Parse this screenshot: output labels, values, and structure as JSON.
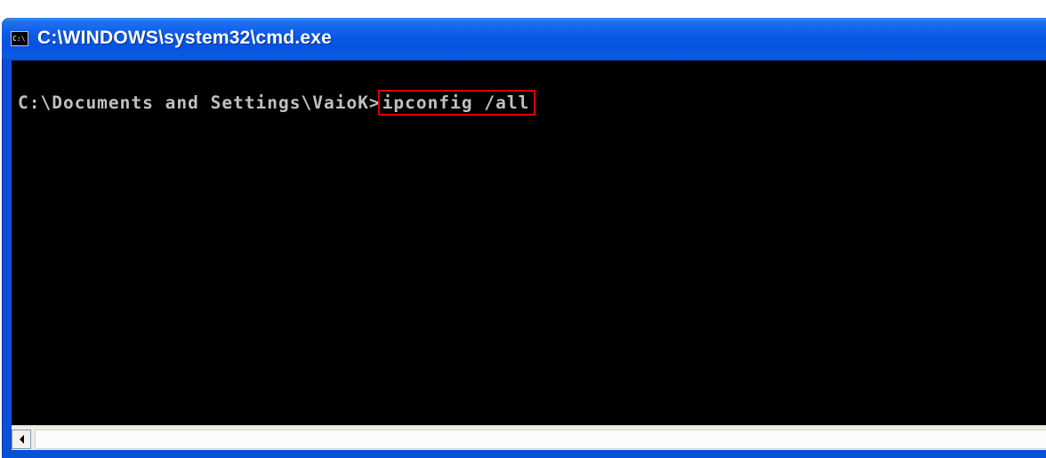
{
  "window": {
    "title": "C:\\WINDOWS\\system32\\cmd.exe",
    "icon": "cmd-icon",
    "icon_text": "C:\\"
  },
  "console": {
    "prompt": "C:\\Documents and Settings\\VaioK>",
    "command": "ipconfig /all",
    "highlight_color": "#e00000",
    "text_color": "#c0c0c0",
    "background_color": "#000000"
  },
  "scrollbar": {
    "left_arrow_icon": "chevron-left-icon"
  }
}
